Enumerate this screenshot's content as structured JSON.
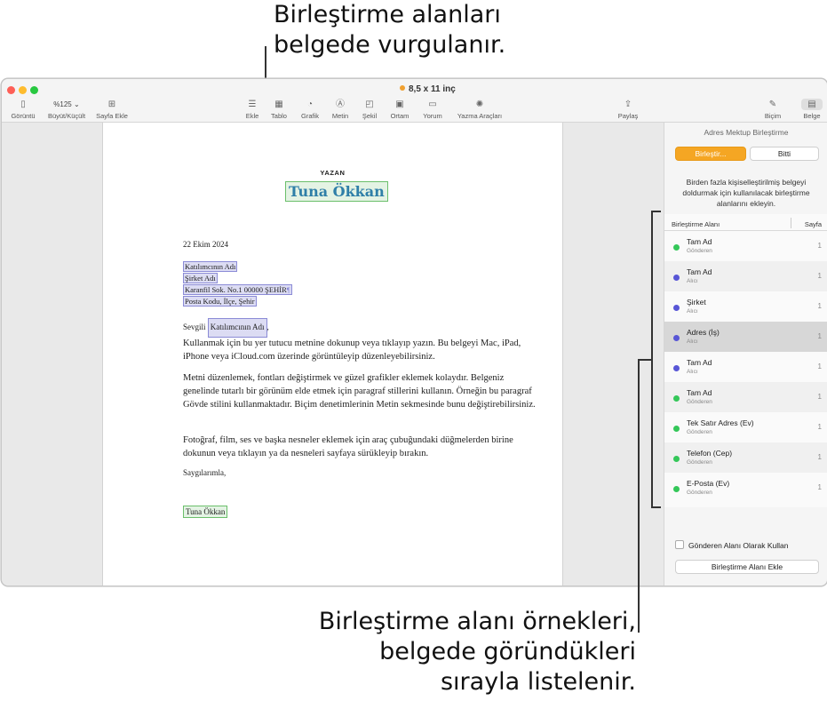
{
  "callouts": {
    "top_line1": "Birleştirme alanları",
    "top_line2": "belgede vurgulanır.",
    "bottom_line1": "Birleştirme alanı örnekleri,",
    "bottom_line2": "belgede göründükleri",
    "bottom_line3": "sırayla listelenir."
  },
  "window": {
    "title": "8,5 x 11 inç"
  },
  "toolbar": {
    "view": "Görüntü",
    "zoom_value": "%125",
    "zoom": "Büyüt/Küçült",
    "add_page": "Sayfa Ekle",
    "insert": "Ekle",
    "table": "Tablo",
    "chart": "Grafik",
    "text": "Metin",
    "shape": "Şekil",
    "media": "Ortam",
    "comment": "Yorum",
    "writing_tools": "Yazma Araçları",
    "share": "Paylaş",
    "format": "Biçim",
    "document": "Belge"
  },
  "document": {
    "sender_label": "YAZAN",
    "sender_name": "Tuna Ökkan",
    "date": "22 Ekim 2024",
    "recipient_name": "Katılımcının Adı",
    "company": "Şirket Adı",
    "address_line": "Karanfil Sok. No.1 00000 ŞEHİR",
    "address_line2": "Posta Kodu, İlçe, Şehir",
    "greeting_prefix": "Sevgili ",
    "greeting_field": "Katılımcının Adı",
    "greeting_suffix": ",",
    "para1": "Kullanmak için bu yer tutucu metnine dokunup veya tıklayıp yazın. Bu belgeyi Mac, iPad, iPhone veya iCloud.com üzerinde görüntüleyip düzenleyebilirsiniz.",
    "para2": "Metni düzenlemek, fontları değiştirmek ve güzel grafikler eklemek kolaydır. Belgeniz genelinde tutarlı bir görünüm elde etmek için paragraf stillerini kullanın. Örneğin bu paragraf Gövde stilini kullanmaktadır. Biçim denetimlerinin Metin sekmesinde bunu değiştirebilirsiniz.",
    "para3": "Fotoğraf, film, ses ve başka nesneler eklemek için araç çubuğundaki düğmelerden birine dokunun veya tıklayın ya da nesneleri sayfaya sürükleyip bırakın.",
    "closing": "Saygılarımla,",
    "signature": "Tuna Ökkan"
  },
  "sidebar": {
    "title": "Adres Mektup Birleştirme",
    "merge_button": "Birleştir...",
    "done_button": "Bitti",
    "description": "Birden fazla kişiselleştirilmiş belgeyi doldurmak için kullanılacak birleştirme alanlarını ekleyin.",
    "col_field": "Birleştirme Alanı",
    "col_page": "Sayfa",
    "fields": [
      {
        "name": "Tam Ad",
        "role": "Gönderen",
        "page": "1",
        "color": "#34c759"
      },
      {
        "name": "Tam Ad",
        "role": "Alıcı",
        "page": "1",
        "color": "#5856d6"
      },
      {
        "name": "Şirket",
        "role": "Alıcı",
        "page": "1",
        "color": "#5856d6"
      },
      {
        "name": "Adres (İş)",
        "role": "Alıcı",
        "page": "1",
        "color": "#5856d6"
      },
      {
        "name": "Tam Ad",
        "role": "Alıcı",
        "page": "1",
        "color": "#5856d6"
      },
      {
        "name": "Tam Ad",
        "role": "Gönderen",
        "page": "1",
        "color": "#34c759"
      },
      {
        "name": "Tek Satır Adres (Ev)",
        "role": "Gönderen",
        "page": "1",
        "color": "#34c759"
      },
      {
        "name": "Telefon (Cep)",
        "role": "Gönderen",
        "page": "1",
        "color": "#34c759"
      },
      {
        "name": "E-Posta (Ev)",
        "role": "Gönderen",
        "page": "1",
        "color": "#34c759"
      }
    ],
    "checkbox_label": "Gönderen Alanı Olarak Kullan",
    "add_button": "Birleştirme Alanı Ekle"
  }
}
